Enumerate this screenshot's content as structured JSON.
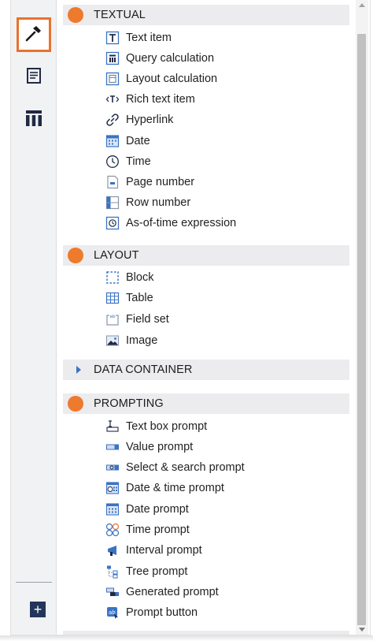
{
  "sidebar": {
    "buttons": [
      {
        "icon": "hammer-icon",
        "active": true
      },
      {
        "icon": "page-icon",
        "active": false
      },
      {
        "icon": "table-icon",
        "active": false
      }
    ],
    "add_label": "+"
  },
  "accent_colors": {
    "dot": "#ee7a2e",
    "icon_blue": "#3b73c4",
    "active_border": "#e8732d"
  },
  "sections": {
    "textual": {
      "title": "TEXTUAL",
      "items": [
        {
          "label": "Text item",
          "icon": "text-item-icon"
        },
        {
          "label": "Query calculation",
          "icon": "query-calculation-icon"
        },
        {
          "label": "Layout calculation",
          "icon": "layout-calculation-icon"
        },
        {
          "label": "Rich text item",
          "icon": "rich-text-icon"
        },
        {
          "label": "Hyperlink",
          "icon": "hyperlink-icon"
        },
        {
          "label": "Date",
          "icon": "date-icon"
        },
        {
          "label": "Time",
          "icon": "time-icon"
        },
        {
          "label": "Page number",
          "icon": "page-number-icon"
        },
        {
          "label": "Row number",
          "icon": "row-number-icon"
        },
        {
          "label": "As-of-time expression",
          "icon": "as-of-time-icon"
        }
      ]
    },
    "layout": {
      "title": "LAYOUT",
      "items": [
        {
          "label": "Block",
          "icon": "block-icon"
        },
        {
          "label": "Table",
          "icon": "table-grid-icon"
        },
        {
          "label": "Field set",
          "icon": "field-set-icon"
        },
        {
          "label": "Image",
          "icon": "image-icon"
        }
      ]
    },
    "data_container": {
      "title": "DATA CONTAINER",
      "collapsed": true
    },
    "prompting": {
      "title": "PROMPTING",
      "items": [
        {
          "label": "Text box prompt",
          "icon": "text-box-prompt-icon"
        },
        {
          "label": "Value prompt",
          "icon": "value-prompt-icon"
        },
        {
          "label": "Select & search prompt",
          "icon": "select-search-prompt-icon"
        },
        {
          "label": "Date & time prompt",
          "icon": "date-time-prompt-icon"
        },
        {
          "label": "Date prompt",
          "icon": "date-prompt-icon"
        },
        {
          "label": "Time prompt",
          "icon": "time-prompt-icon"
        },
        {
          "label": "Interval prompt",
          "icon": "interval-prompt-icon"
        },
        {
          "label": "Tree prompt",
          "icon": "tree-prompt-icon"
        },
        {
          "label": "Generated prompt",
          "icon": "generated-prompt-icon"
        },
        {
          "label": "Prompt button",
          "icon": "prompt-button-icon"
        }
      ]
    }
  }
}
